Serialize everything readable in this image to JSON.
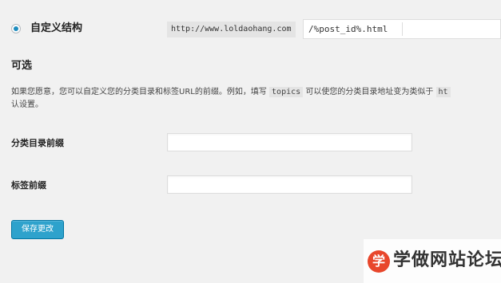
{
  "permalink": {
    "custom_label": "自定义结构",
    "base_url": "http://www.loldaohang.com",
    "structure_value": "/%post_id%.html"
  },
  "optional": {
    "title": "可选",
    "desc_part1": "如果您愿意，您可以自定义您的分类目录和标签URL的前缀。例如，填写",
    "desc_code1": "topics",
    "desc_part2": "可以使您的分类目录地址变为类似于",
    "desc_code2": "ht",
    "desc_line2": "认设置。",
    "category_base_label": "分类目录前缀",
    "category_base_value": "",
    "tag_base_label": "标签前缀",
    "tag_base_value": ""
  },
  "save_button_label": "保存更改",
  "watermark": {
    "logo_char": "学",
    "text": "学做网站论坛"
  }
}
